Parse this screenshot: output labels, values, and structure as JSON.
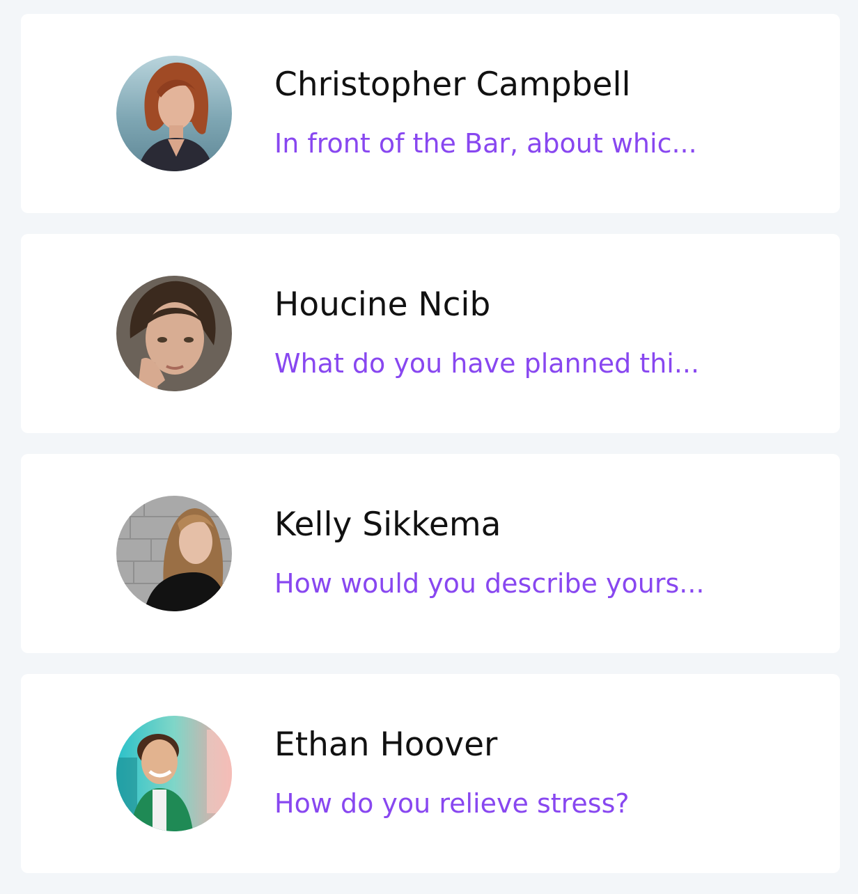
{
  "colors": {
    "background": "#f3f6f9",
    "card": "#ffffff",
    "name": "#111111",
    "message": "#8847f0"
  },
  "conversations": [
    {
      "name": "Christopher Campbell",
      "message": "In front of the Bar, about whic...",
      "avatar_icon": "avatar-photo-icon"
    },
    {
      "name": "Houcine Ncib",
      "message": "What do you have planned thi...",
      "avatar_icon": "avatar-photo-icon"
    },
    {
      "name": "Kelly Sikkema",
      "message": "How would you describe yours...",
      "avatar_icon": "avatar-photo-icon"
    },
    {
      "name": "Ethan Hoover",
      "message": "How do you relieve stress?",
      "avatar_icon": "avatar-photo-icon"
    }
  ]
}
